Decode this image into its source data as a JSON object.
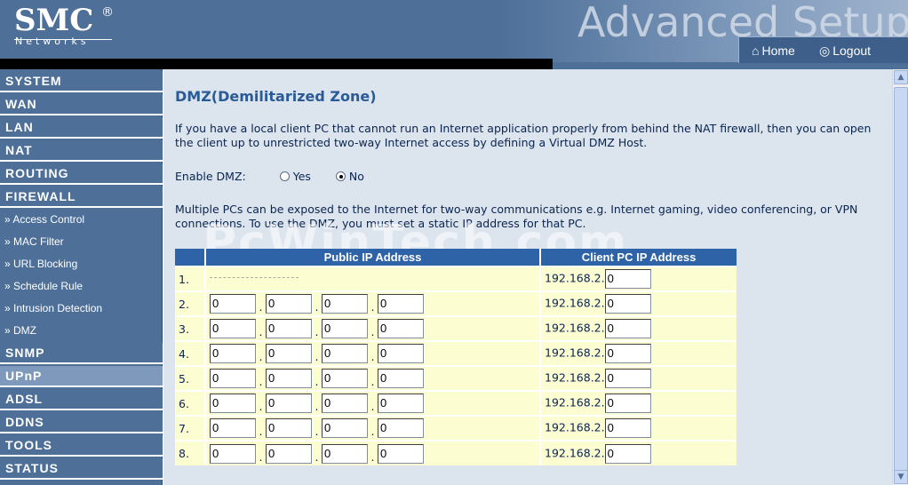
{
  "header": {
    "brand": "SMC",
    "registered": "®",
    "brand_sub": "Networks",
    "banner_title": "Advanced Setup",
    "home_label": "Home",
    "logout_label": "Logout"
  },
  "sidebar": {
    "sections_top": [
      {
        "label": "SYSTEM"
      },
      {
        "label": "WAN"
      },
      {
        "label": "LAN"
      },
      {
        "label": "NAT"
      },
      {
        "label": "ROUTING"
      },
      {
        "label": "FIREWALL"
      }
    ],
    "firewall_items": [
      {
        "label": "» Access Control"
      },
      {
        "label": "» MAC Filter"
      },
      {
        "label": "» URL Blocking"
      },
      {
        "label": "» Schedule Rule"
      },
      {
        "label": "» Intrusion Detection"
      },
      {
        "label": "» DMZ"
      }
    ],
    "sections_bottom": [
      {
        "label": "SNMP"
      },
      {
        "label": "UPnP"
      },
      {
        "label": "ADSL"
      },
      {
        "label": "DDNS"
      },
      {
        "label": "TOOLS"
      },
      {
        "label": "STATUS"
      }
    ]
  },
  "main": {
    "title": "DMZ(Demilitarized Zone)",
    "intro": "If you have a local client PC that cannot run an Internet application properly from behind the NAT firewall, then you can open the client up to unrestricted two-way Internet access by defining a Virtual DMZ Host.",
    "enable_label": "Enable DMZ:",
    "option_yes": "Yes",
    "option_no": "No",
    "enable_selected": "No",
    "multi_text": "Multiple PCs can be exposed to the Internet for two-way communications e.g. Internet gaming, video conferencing, or VPN connections.  To use the DMZ, you must set a static IP address for that PC.",
    "watermark": "PcWinTech.com",
    "table": {
      "col_public": "Public IP Address",
      "col_client": "Client PC IP Address",
      "client_prefix": "192.168.2.",
      "rows": [
        {
          "num": "1.",
          "public": [],
          "client": "0"
        },
        {
          "num": "2.",
          "public": [
            "0",
            "0",
            "0",
            "0"
          ],
          "client": "0"
        },
        {
          "num": "3.",
          "public": [
            "0",
            "0",
            "0",
            "0"
          ],
          "client": "0"
        },
        {
          "num": "4.",
          "public": [
            "0",
            "0",
            "0",
            "0"
          ],
          "client": "0"
        },
        {
          "num": "5.",
          "public": [
            "0",
            "0",
            "0",
            "0"
          ],
          "client": "0"
        },
        {
          "num": "6.",
          "public": [
            "0",
            "0",
            "0",
            "0"
          ],
          "client": "0"
        },
        {
          "num": "7.",
          "public": [
            "0",
            "0",
            "0",
            "0"
          ],
          "client": "0"
        },
        {
          "num": "8.",
          "public": [
            "0",
            "0",
            "0",
            "0"
          ],
          "client": "0"
        }
      ]
    }
  },
  "colors": {
    "sidebar_bg": "#4d6f98",
    "sidebar_active": "#7e99bb",
    "content_bg": "#dce4ee",
    "table_header": "#2f63a8",
    "table_row": "#fdfdd2",
    "title_color": "#2a5b96"
  }
}
